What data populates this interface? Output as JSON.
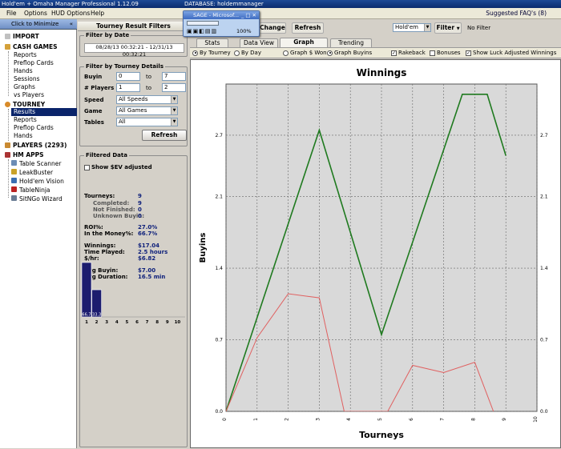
{
  "window": {
    "title": "Hold'em + Omaha Manager Professional 1.12.09",
    "database": "DATABASE: holdemmanager"
  },
  "menu": {
    "items": [
      "File",
      "Options",
      "HUD Options",
      "Help"
    ],
    "faq": "Suggested FAQ's (8)"
  },
  "sidebar": {
    "minimize": "Click to Minimize",
    "import": "IMPORT",
    "cash_games": "CASH GAMES",
    "cash_items": [
      "Reports",
      "Preflop Cards",
      "Hands",
      "Sessions",
      "Graphs",
      "vs Players"
    ],
    "tourney": "TOURNEY",
    "tourney_items": [
      "Results",
      "Reports",
      "Preflop Cards",
      "Hands"
    ],
    "players": "PLAYERS (2293)",
    "hm_apps": "HM APPS",
    "apps": [
      "Table Scanner",
      "LeakBuster",
      "Hold'em Vision",
      "TableNinja",
      "SitNGo Wizard"
    ]
  },
  "filters": {
    "title": "Tourney Result Filters",
    "date_group": "Filter by Date",
    "date_from": "08/28/13 00:32:21",
    "date_to": "12/31/13 00:32:21",
    "details_group": "Filter by Tourney Details",
    "buyin_label": "Buyin",
    "buyin_from": "0",
    "buyin_to": "7",
    "players_label": "# Players",
    "players_from": "1",
    "players_to": "2",
    "to_label": "to",
    "speed_label": "Speed",
    "speed_value": "All Speeds",
    "game_label": "Game",
    "game_value": "All Games",
    "tables_label": "Tables",
    "tables_value": "All",
    "refresh": "Refresh"
  },
  "filtered": {
    "title": "Filtered Data",
    "show_ev": "Show $EV adjusted",
    "rows": [
      {
        "label": "Tourneys:",
        "value": "9",
        "sub": false
      },
      {
        "label": "Completed:",
        "value": "9",
        "sub": true
      },
      {
        "label": "Not Finished:",
        "value": "0",
        "sub": true
      },
      {
        "label": "Unknown Buyin:",
        "value": "0",
        "sub": true
      },
      {
        "label": "ROI%:",
        "value": "27.0%",
        "sub": false
      },
      {
        "label": "In the Money%:",
        "value": "66.7%",
        "sub": false
      },
      {
        "label": "Winnings:",
        "value": "$17.04",
        "sub": false
      },
      {
        "label": "Time Played:",
        "value": "2.5 hours",
        "sub": false
      },
      {
        "label": "$/hr:",
        "value": "$6.82",
        "sub": false
      },
      {
        "label": "Avg Buyin:",
        "value": "$7.00",
        "sub": false
      },
      {
        "label": "Avg Duration:",
        "value": "16.5 min",
        "sub": false
      }
    ],
    "mini_chart": {
      "categories": [
        "1",
        "2",
        "3",
        "4",
        "5",
        "6",
        "7",
        "8",
        "9",
        "10"
      ],
      "values": [
        66.7,
        33.3,
        0,
        0,
        0,
        0,
        0,
        0,
        0,
        0
      ],
      "labels": [
        "66.7",
        "33.3"
      ]
    }
  },
  "topbar": {
    "change": "Change",
    "refresh": "Refresh",
    "game_select": "Hold'em",
    "filter": "Filter",
    "no_filter": "No Filter"
  },
  "tabs": [
    "Stats",
    "Data View",
    "Graph",
    "Trending"
  ],
  "options": {
    "by_tourney": "By Tourney",
    "by_day": "By Day",
    "graph_won": "Graph $ Won",
    "graph_buyins": "Graph Buyins",
    "rakeback": "Rakeback",
    "bonuses": "Bonuses",
    "luck": "Show Luck Adjusted Winnings"
  },
  "sage": {
    "title": "SAGE - Microsof...",
    "zoom": "100%"
  },
  "colors": {
    "green": "#1f7a1f",
    "red": "#e06060",
    "nav_selected": "#0a246a",
    "mini_bar": "#1c1c6e"
  },
  "chart_data": {
    "type": "line",
    "title": "Winnings",
    "xlabel": "Tourneys",
    "ylabel": "Buyins",
    "x_ticks": [
      "0",
      "1",
      "2",
      "3",
      "4",
      "5",
      "6",
      "7",
      "8",
      "9",
      "10"
    ],
    "y_ticks": [
      "0.0",
      "0.7",
      "1.4",
      "2.1",
      "2.7"
    ],
    "xlim": [
      0,
      10
    ],
    "ylim": [
      0,
      2.7
    ],
    "grid": true,
    "series": [
      {
        "x": [
          0,
          3,
          5,
          7.6,
          8.4,
          9
        ],
        "values": [
          0,
          2.75,
          0.75,
          3.1,
          3.1,
          2.5
        ]
      },
      {
        "x": [
          0,
          1,
          2,
          3,
          3.8,
          5.2,
          6,
          7,
          8,
          8.6
        ],
        "values": [
          0,
          0.72,
          1.15,
          1.11,
          0,
          0,
          0.45,
          0.38,
          0.48,
          0
        ]
      }
    ]
  }
}
